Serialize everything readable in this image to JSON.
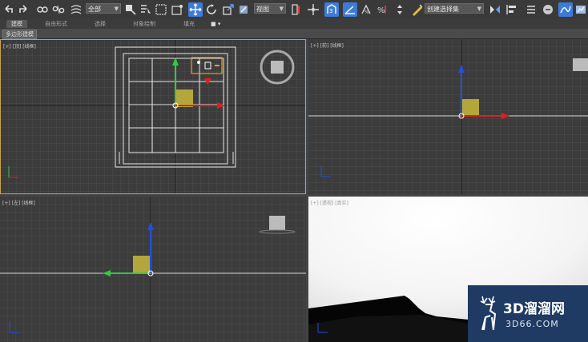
{
  "toolbar": {
    "dropdown_selection": "全部",
    "dropdown_view": "视图",
    "dropdown_named_selection": "创建选择集",
    "colors": {
      "bg": "#3a3a3a",
      "active": "#3d7bd9"
    },
    "icons": [
      "undo-icon",
      "redo-icon",
      "link-icon",
      "unlink-icon",
      "bind-spacewarp-icon",
      "select-object-icon",
      "select-by-name-icon",
      "rectangle-selection-icon",
      "window-crossing-icon",
      "select-move-icon",
      "select-rotate-icon",
      "select-scale-icon",
      "select-manipulate-icon",
      "keyboard-shortcut-icon",
      "snap-toggle-icon",
      "angle-snap-icon",
      "percent-snap-icon",
      "spinner-snap-icon",
      "edit-named-selection-icon",
      "mirror-icon",
      "align-icon",
      "layer-manager-icon",
      "graphite-tools-icon",
      "curve-editor-icon",
      "schematic-view-icon",
      "material-editor-icon",
      "render-setup-icon",
      "rendered-frame-icon",
      "render-icon"
    ]
  },
  "ribbon": {
    "tabs": [
      "建模",
      "自由形式",
      "选择",
      "对象绘制",
      "填充"
    ],
    "active_tab": "建模",
    "panel_button": "多边形建模"
  },
  "viewports": {
    "top": {
      "label": "[+] [顶] [线框]",
      "active": true
    },
    "front": {
      "label": "[+] [前] [线框]"
    },
    "left": {
      "label": "[+] [左] [线框]"
    },
    "perspective": {
      "label": "[+] [透视] [真实]"
    }
  },
  "watermark": {
    "main": "3D溜溜网",
    "sub": "3D66.COM"
  }
}
